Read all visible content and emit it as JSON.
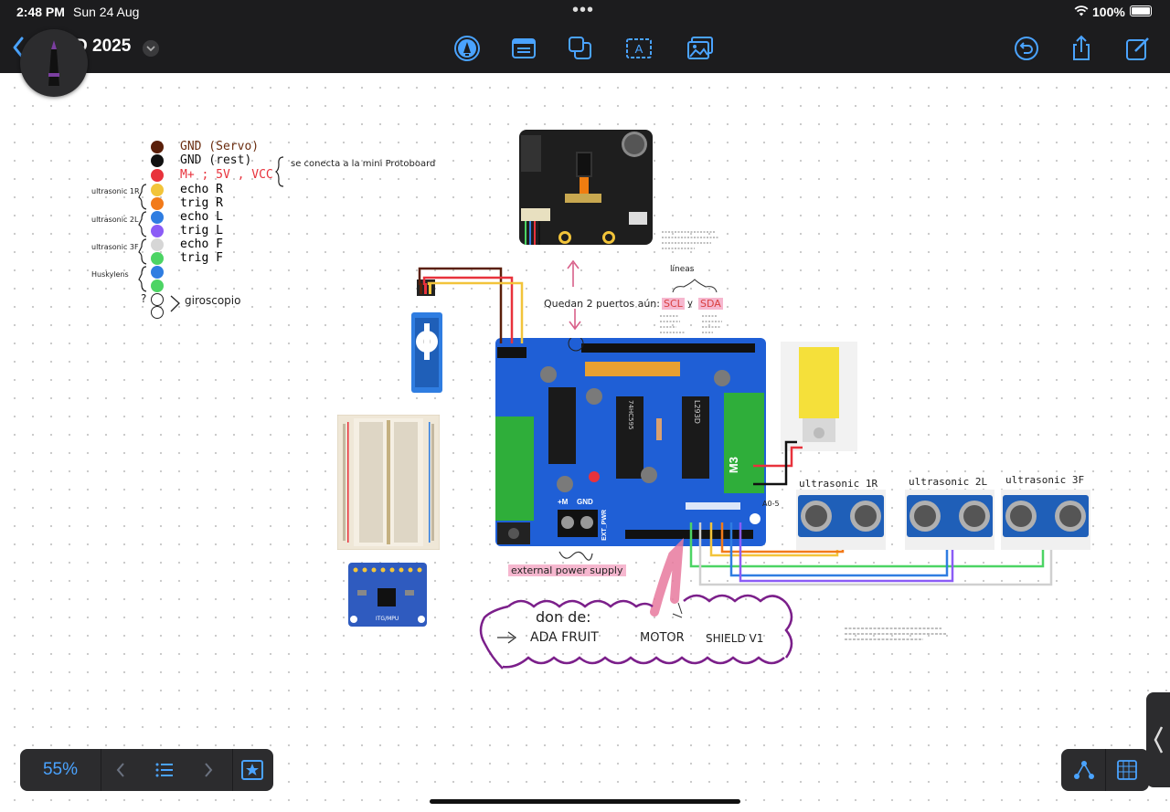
{
  "status": {
    "time": "2:48 PM",
    "date": "Sun 24 Aug",
    "battery": "100%"
  },
  "toolbar": {
    "title": "D 2025",
    "icons": [
      "back-chevron-icon",
      "pen-icon",
      "text-box-icon",
      "shapes-icon",
      "textfield-icon",
      "image-icon",
      "undo-icon",
      "share-icon",
      "edit-icon"
    ]
  },
  "legend": {
    "rows": [
      {
        "color": "#5a1f0a",
        "text": "GND (Servo)",
        "text_color": "#6b2d10"
      },
      {
        "color": "#111111",
        "text": "GND (rest)",
        "text_color": "#111111"
      },
      {
        "color": "#e8323c",
        "text": "M+ ; 5V , VCC",
        "text_color": "#e8323c"
      },
      {
        "color": "#f2c43a",
        "text": "echo  R",
        "text_color": "#222222"
      },
      {
        "color": "#f27a1a",
        "text": "trig  R",
        "text_color": "#222222"
      },
      {
        "color": "#2f7de1",
        "text": "echo  L",
        "text_color": "#222222"
      },
      {
        "color": "#8b5cf6",
        "text": "trig  L",
        "text_color": "#222222"
      },
      {
        "color": "#d6d6d6",
        "text": "echo  F",
        "text_color": "#222222"
      },
      {
        "color": "#4cd464",
        "text": "trig  F",
        "text_color": "#222222"
      },
      {
        "color": "#2f7de1",
        "text": "",
        "text_color": "#222222"
      },
      {
        "color": "#4cd464",
        "text": "",
        "text_color": "#222222"
      },
      {
        "color": "#ffffff",
        "text": "",
        "text_color": "#222222"
      },
      {
        "color": "#ffffff",
        "text": "",
        "text_color": "#222222"
      }
    ],
    "protoboard_note": "se conecta a la mini Protoboard",
    "side_labels": {
      "u1": "ultrasonic 1R",
      "u2": "ultrasonic 2L",
      "u3": "ultrasonic 3F",
      "husky": "Huskylens",
      "q": "?"
    },
    "giroscopio": "giroscopio"
  },
  "notes": {
    "quedan": "Quedan 2 puertos aún:",
    "scl": "SCL",
    "y": "y",
    "sda": "SDA",
    "lineas": "líneas",
    "external_supply": "external power supply",
    "donde": "don de:",
    "adafruit": "ADA FRUIT",
    "motor": "MOTOR",
    "shield": "SHIELD V1",
    "a05": "A0-5"
  },
  "sensors": {
    "s1": "ultrasonic 1R",
    "s2": "ultrasonic 2L",
    "s3": "ultrasonic 3F"
  },
  "board": {
    "chip1": "74HC595",
    "chip2": "L293D",
    "m3": "M3",
    "pm": "+M",
    "gnd": "GND",
    "ext": "EXT_PWR"
  },
  "gyro_board": {
    "label": "ITG/MPU"
  },
  "bottom": {
    "zoom": "55%"
  }
}
